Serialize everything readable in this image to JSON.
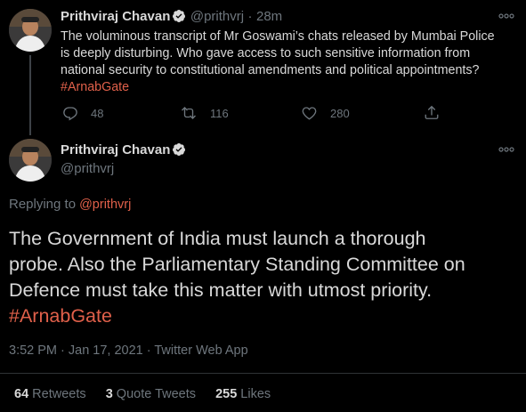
{
  "tweet1": {
    "name": "Prithviraj Chavan",
    "handle": "@prithvrj",
    "dot": "·",
    "time": "28m",
    "text_line1": "The voluminous transcript of Mr Goswami’s chats released by Mumbai Police",
    "text_line2": "is deeply disturbing. Who gave access to such sensitive information from",
    "text_line3": "national security to constitutional amendments and political appointments?",
    "hashtag": "#ArnabGate",
    "replies": "48",
    "retweets": "116",
    "likes": "280"
  },
  "tweet2": {
    "name": "Prithviraj Chavan",
    "handle": "@prithvrj",
    "replying_label": "Replying to",
    "replying_handle": "@prithvrj",
    "text_line1": "The Government of India must launch a thorough",
    "text_line2": "probe. Also the Parliamentary Standing Committee on",
    "text_line3": "Defence must take this matter with utmost priority.",
    "hashtag": "#ArnabGate",
    "timestamp": "3:52 PM · Jan 17, 2021 · Twitter Web App",
    "retweets_count": "64",
    "retweets_label": "Retweets",
    "quotes_count": "3",
    "quotes_label": "Quote Tweets",
    "likes_count": "255",
    "likes_label": "Likes"
  },
  "colors": {
    "background": "#000000",
    "text": "#d9d9d9",
    "muted": "#6e767d",
    "hashtag": "#e0604a",
    "verified": "#d9d9d9",
    "divider": "#2f3336"
  },
  "icons": {
    "reply": "reply-icon",
    "retweet": "retweet-icon",
    "like": "heart-icon",
    "share": "share-icon",
    "more": "more-icon",
    "verified": "verified-badge-icon"
  }
}
